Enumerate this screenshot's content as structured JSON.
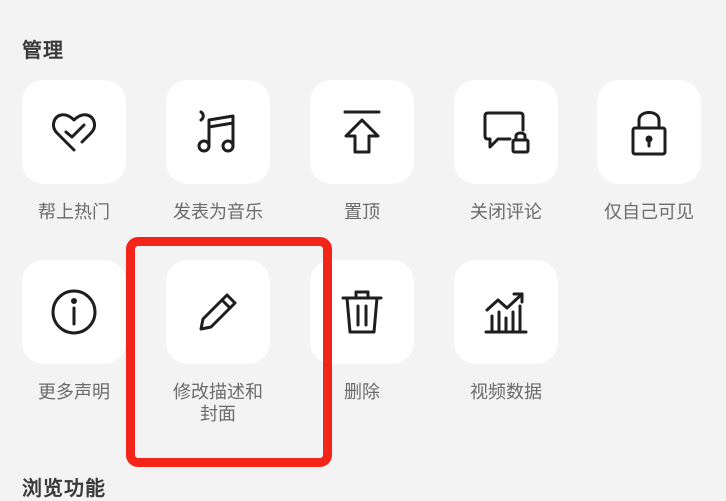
{
  "sections": {
    "manage_title": "管理",
    "browse_title": "浏览功能"
  },
  "actions": [
    {
      "label": "帮上热门",
      "icon": "heart-promote-icon"
    },
    {
      "label": "发表为音乐",
      "icon": "music-note-icon"
    },
    {
      "label": "置顶",
      "icon": "pin-top-icon"
    },
    {
      "label": "关闭评论",
      "icon": "comment-lock-icon"
    },
    {
      "label": "仅自己可见",
      "icon": "lock-icon"
    },
    {
      "label": "更多声明",
      "icon": "info-icon"
    },
    {
      "label": "修改描述和封面",
      "icon": "pencil-icon"
    },
    {
      "label": "删除",
      "icon": "trash-icon"
    },
    {
      "label": "视频数据",
      "icon": "bar-chart-icon"
    }
  ],
  "highlight_color": "#f3251b"
}
